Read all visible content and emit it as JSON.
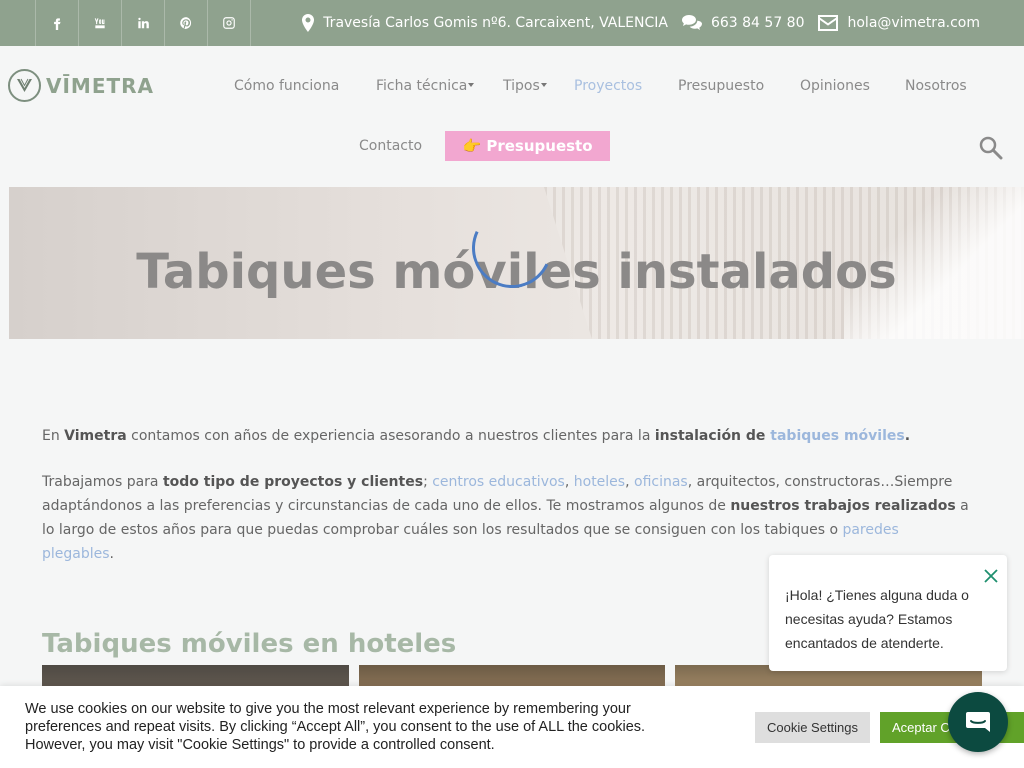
{
  "topbar": {
    "social": [
      "facebook-icon",
      "youtube-icon",
      "linkedin-icon",
      "pinterest-icon",
      "instagram-icon"
    ],
    "address": "Travesía Carlos Gomis nº6. Carcaixent, VALENCIA",
    "phone": "663 84 57 80",
    "email": "hola@vimetra.com",
    "bg_color": "#8fa28e"
  },
  "header": {
    "logo_text": "VĪMETRA",
    "nav": {
      "como_funciona": "Cómo funciona",
      "ficha_tecnica": "Ficha técnica",
      "tipos": "Tipos",
      "proyectos": "Proyectos",
      "presupuesto": "Presupuesto",
      "opiniones": "Opiniones",
      "nosotros": "Nosotros",
      "contacto": "Contacto"
    },
    "cta_label": "👉 Presupuesto",
    "cta_color": "#f2a7d0",
    "active_color": "#a9c0e0"
  },
  "hero": {
    "title": "Tabiques móviles instalados"
  },
  "intro": {
    "p1": {
      "t1": "En ",
      "b1": "Vimetra",
      "t2": " contamos con años de experiencia asesorando a nuestros clientes para la ",
      "b2": "instalación de ",
      "link": "tabiques móviles",
      "end": "."
    },
    "p2": {
      "t1": "Trabajamos para ",
      "b1": "todo tipo de proyectos y clientes",
      "t2": "; ",
      "l1": "centros educativos",
      "c1": ", ",
      "l2": "hoteles",
      "c2": ", ",
      "l3": "oficinas",
      "t3": ", arquitectos, constructoras…Siempre adaptándonos a las preferencias y circunstancias de cada uno de ellos. Te mostramos algunos de ",
      "b2": "nuestros trabajos realizados",
      "t4": " a lo largo de estos años para que puedas comprobar cuáles son los resultados que se consiguen con los tabiques o ",
      "l4": "paredes plegables",
      "end": "."
    }
  },
  "section": {
    "title": "Tabiques móviles en hoteles"
  },
  "chat": {
    "message": "¡Hola! ¿Tienes alguna duda o necesitas ayuda? Estamos encantados de atenderte."
  },
  "cookie": {
    "text": "We use cookies on our website to give you the most relevant experience by remembering your preferences and repeat visits. By clicking “Accept All”, you consent to the use of ALL the cookies. However, you may visit \"Cookie Settings\" to provide a controlled consent.",
    "settings_label": "Cookie Settings",
    "accept_label": "Aceptar Cookies",
    "accept_color": "#61a229"
  }
}
